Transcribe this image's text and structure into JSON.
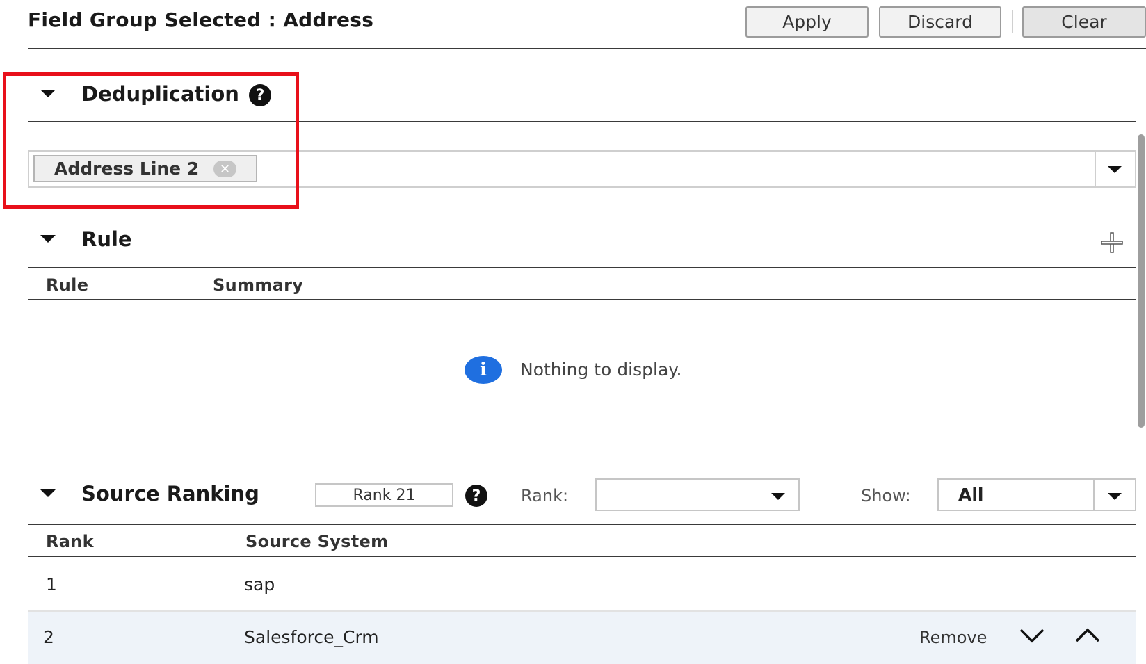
{
  "header": {
    "title": "Field Group Selected : Address",
    "apply_label": "Apply",
    "discard_label": "Discard",
    "clear_label": "Clear"
  },
  "deduplication": {
    "title": "Deduplication",
    "help_glyph": "?",
    "selected_tags": [
      {
        "label": "Address Line 2",
        "remove_glyph": "✕"
      }
    ]
  },
  "rule": {
    "title": "Rule",
    "columns": [
      "Rule",
      "Summary"
    ],
    "empty_message": "Nothing to display.",
    "info_glyph": "i"
  },
  "source_ranking": {
    "title": "Source Ranking",
    "rank_badge": "Rank 21",
    "help_glyph": "?",
    "rank_label": "Rank:",
    "rank_value": "",
    "show_label": "Show:",
    "show_value": "All",
    "columns": [
      "Rank",
      "Source System"
    ],
    "rows": [
      {
        "rank": "1",
        "source": "sap"
      },
      {
        "rank": "2",
        "source": "Salesforce_Crm",
        "remove_label": "Remove"
      }
    ]
  },
  "colors": {
    "highlight": "#e8101a",
    "info": "#1f6fe0",
    "selected_row": "#eef3f9"
  }
}
